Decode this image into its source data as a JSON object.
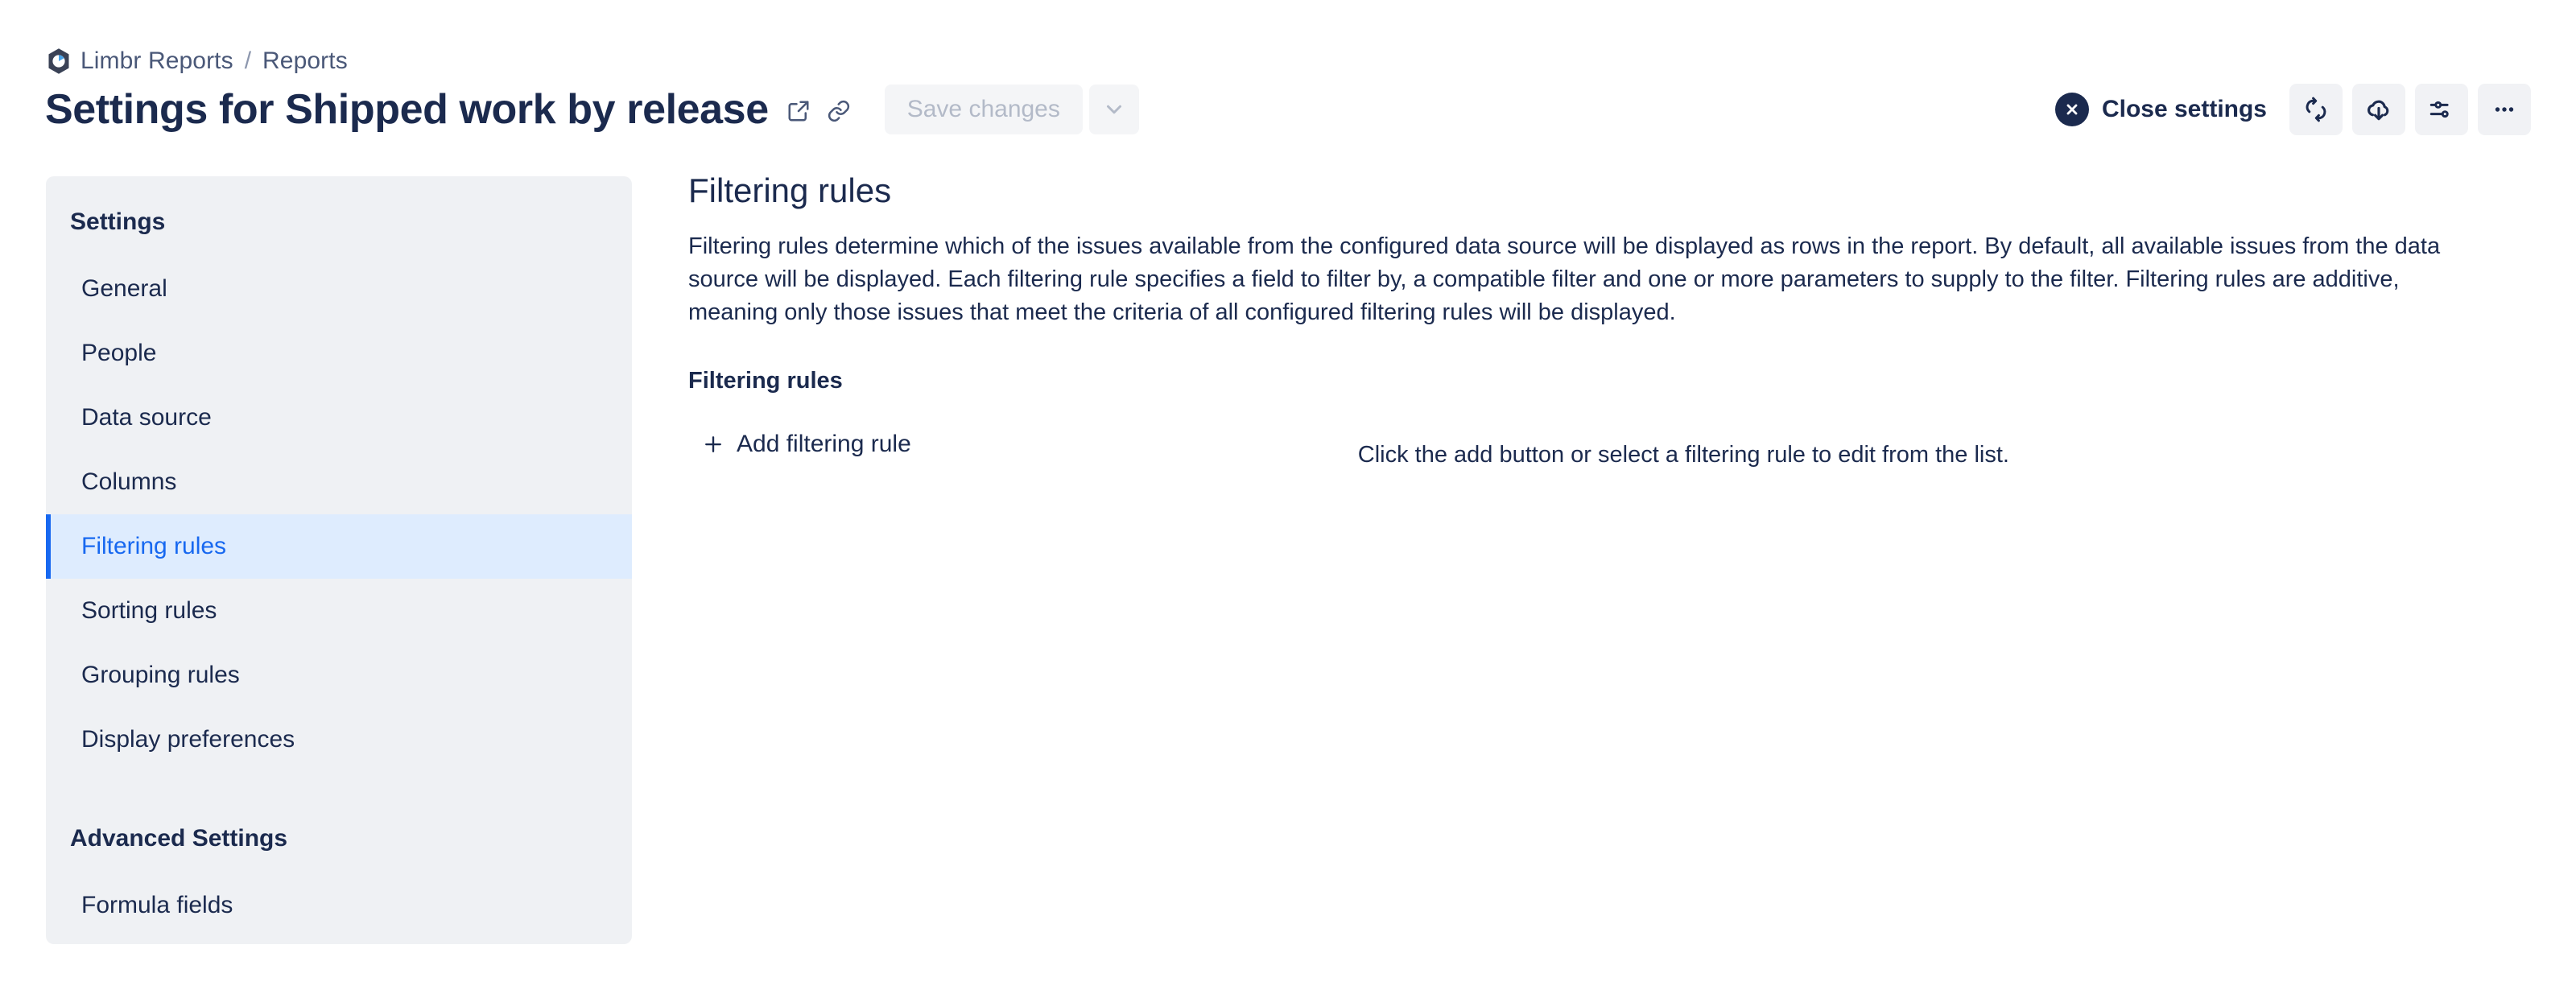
{
  "breadcrumb": {
    "logo_icon": "limbr-hexagon-logo",
    "items": [
      {
        "label": "Limbr Reports"
      },
      {
        "label": "Reports"
      }
    ],
    "separator": "/"
  },
  "header": {
    "title": "Settings for Shipped work by release",
    "open_in_new_icon": "external-link-icon",
    "copy_link_icon": "link-icon",
    "save_label": "Save changes",
    "save_caret_icon": "chevron-down-icon",
    "close_settings_label": "Close settings",
    "close_icon": "close-x-icon",
    "actions": [
      {
        "icon": "refresh-icon",
        "name": "refresh-button"
      },
      {
        "icon": "cloud-download-icon",
        "name": "export-button"
      },
      {
        "icon": "sliders-icon",
        "name": "display-options-button"
      },
      {
        "icon": "ellipsis-icon",
        "name": "more-options-button"
      }
    ]
  },
  "sidebar": {
    "settings_group_label": "Settings",
    "items": [
      {
        "label": "General",
        "active": false
      },
      {
        "label": "People",
        "active": false
      },
      {
        "label": "Data source",
        "active": false
      },
      {
        "label": "Columns",
        "active": false
      },
      {
        "label": "Filtering rules",
        "active": true
      },
      {
        "label": "Sorting rules",
        "active": false
      },
      {
        "label": "Grouping rules",
        "active": false
      },
      {
        "label": "Display preferences",
        "active": false
      }
    ],
    "advanced_group_label": "Advanced Settings",
    "advanced_items": [
      {
        "label": "Formula fields",
        "active": false
      }
    ]
  },
  "main": {
    "heading": "Filtering rules",
    "description": "Filtering rules determine which of the issues available from the configured data source will be displayed as rows in the report. By default, all available issues from the data source will be displayed. Each filtering rule specifies a field to filter by, a compatible filter and one or more parameters to supply to the filter. Filtering rules are additive, meaning only those issues that meet the criteria of all configured filtering rules will be displayed.",
    "sub_heading": "Filtering rules",
    "add_rule_label": "Add filtering rule",
    "add_rule_icon": "plus-icon",
    "empty_hint": "Click the add button or select a filtering rule to edit from the list."
  },
  "colors": {
    "accent_blue": "#1768f0",
    "active_bg": "#deecfe",
    "text_dark": "#1b2a4e",
    "muted_text": "#4a5878",
    "panel_bg": "#eff1f4",
    "button_bg": "#f1f2f5",
    "disabled_text": "#b3bac8"
  }
}
